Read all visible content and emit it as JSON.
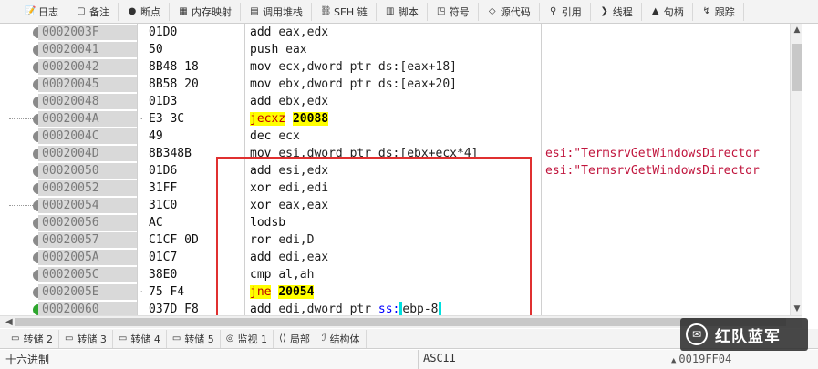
{
  "top_tabs": [
    {
      "icon": "log-icon",
      "glyph": "📝",
      "label": "日志"
    },
    {
      "icon": "notes-icon",
      "glyph": "▢",
      "label": "备注"
    },
    {
      "icon": "breakpoint-icon",
      "glyph": "●",
      "label": "断点"
    },
    {
      "icon": "memory-map-icon",
      "glyph": "▦",
      "label": "内存映射"
    },
    {
      "icon": "call-stack-icon",
      "glyph": "▤",
      "label": "调用堆栈"
    },
    {
      "icon": "seh-chain-icon",
      "glyph": "⛓",
      "label": "SEH 链"
    },
    {
      "icon": "script-icon",
      "glyph": "▥",
      "label": "脚本"
    },
    {
      "icon": "symbols-icon",
      "glyph": "◳",
      "label": "符号"
    },
    {
      "icon": "source-icon",
      "glyph": "◇",
      "label": "源代码"
    },
    {
      "icon": "references-icon",
      "glyph": "⚲",
      "label": "引用"
    },
    {
      "icon": "threads-icon",
      "glyph": "❯",
      "label": "线程"
    },
    {
      "icon": "handles-icon",
      "glyph": "▲",
      "label": "句柄"
    },
    {
      "icon": "trace-icon",
      "glyph": "↯",
      "label": "跟踪"
    }
  ],
  "disassembly": {
    "rows": [
      {
        "addr": "0002003F",
        "bytes": "01D0",
        "instr": "add eax,edx",
        "comment": ""
      },
      {
        "addr": "00020041",
        "bytes": "50",
        "instr": "push eax",
        "comment": ""
      },
      {
        "addr": "00020042",
        "bytes": "8B48 18",
        "instr": "mov ecx,dword ptr ds:[eax+18]",
        "comment": ""
      },
      {
        "addr": "00020045",
        "bytes": "8B58 20",
        "instr": "mov ebx,dword ptr ds:[eax+20]",
        "comment": ""
      },
      {
        "addr": "00020048",
        "bytes": "01D3",
        "instr": "add ebx,edx",
        "comment": ""
      },
      {
        "addr": "0002004A",
        "bytes": "E3 3C",
        "instr": "jecxz 20088",
        "comment": ""
      },
      {
        "addr": "0002004C",
        "bytes": "49",
        "instr": "dec ecx",
        "comment": ""
      },
      {
        "addr": "0002004D",
        "bytes": "8B348B",
        "instr": "mov esi,dword ptr ds:[ebx+ecx*4]",
        "comment": "esi:\"TermsrvGetWindowsDirector"
      },
      {
        "addr": "00020050",
        "bytes": "01D6",
        "instr": "add esi,edx",
        "comment": "esi:\"TermsrvGetWindowsDirector"
      },
      {
        "addr": "00020052",
        "bytes": "31FF",
        "instr": "xor edi,edi",
        "comment": ""
      },
      {
        "addr": "00020054",
        "bytes": "31C0",
        "instr": "xor eax,eax",
        "comment": ""
      },
      {
        "addr": "00020056",
        "bytes": "AC",
        "instr": "lodsb",
        "comment": ""
      },
      {
        "addr": "00020057",
        "bytes": "C1CF 0D",
        "instr": "ror edi,D",
        "comment": ""
      },
      {
        "addr": "0002005A",
        "bytes": "01C7",
        "instr": "add edi,eax",
        "comment": ""
      },
      {
        "addr": "0002005C",
        "bytes": "38E0",
        "instr": "cmp al,ah",
        "comment": ""
      },
      {
        "addr": "0002005E",
        "bytes": "75 F4",
        "instr": "jne 20054",
        "comment": ""
      },
      {
        "addr": "00020060",
        "bytes": "037D F8",
        "instr": "add edi,dword ptr ss:[ebp-8]",
        "comment": ""
      }
    ],
    "jump_rows": [
      5,
      15
    ],
    "jump_mnemonics": [
      "jecxz",
      "jne"
    ],
    "jump_targets": [
      "20088",
      "20054"
    ],
    "current_row": 16,
    "colors": {
      "jump_highlight": "#ffff00",
      "jump_text": "#c00000",
      "comment_text": "#c0143c",
      "address_bg": "#d9d9d9",
      "current_marker": "#2ea62e",
      "selection_box": "#e03030"
    }
  },
  "bottom_tabs": [
    {
      "icon": "dump-icon",
      "label": "转储 2",
      "active": false
    },
    {
      "icon": "dump-icon",
      "label": "转储 3",
      "active": false
    },
    {
      "icon": "dump-icon",
      "label": "转储 4",
      "active": false
    },
    {
      "icon": "dump-icon",
      "label": "转储 5",
      "active": false
    },
    {
      "icon": "watch-icon",
      "label": "监视 1",
      "active": false
    },
    {
      "icon": "locals-icon",
      "label": "局部",
      "active": false
    },
    {
      "icon": "struct-icon",
      "label": "结构体",
      "active": false
    }
  ],
  "dump": {
    "column_hex": "十六进制",
    "column_ascii": "ASCII",
    "stack_addr": "0019FF04"
  },
  "watermark": {
    "text": "红队蓝军"
  }
}
